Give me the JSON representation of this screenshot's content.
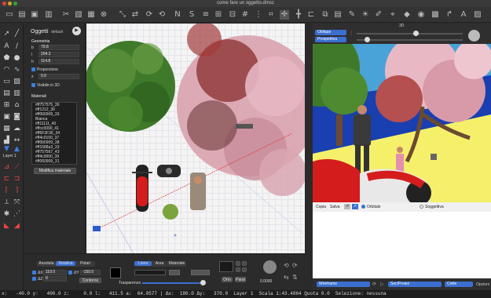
{
  "window": {
    "title": "come fare un oggetto.dmsc"
  },
  "toolbar": {
    "icons": [
      "new-icon",
      "open-icon",
      "save-icon",
      "print-icon",
      "cut-icon",
      "copy-icon",
      "paste-icon",
      "delete-icon",
      "resize-icon",
      "mirror-icon",
      "rotate-icon",
      "N-icon",
      "S-icon",
      "align-icon",
      "grid-icon",
      "snap-icon",
      "move-icon",
      "distribute-icon",
      "group-icon",
      "layers-icon",
      "tool-icon",
      "light-icon",
      "measure-icon",
      "brush-icon",
      "cube-icon",
      "camera-icon",
      "material-icon",
      "hook-icon",
      "text-icon",
      "export-icon"
    ]
  },
  "objects_panel": {
    "title": "Oggetti",
    "mode": "default",
    "section_geometry": "Geometria",
    "b_label": "b",
    "b_value": "79.8",
    "l_label": "l",
    "l_value": "204.2",
    "h_label": "h",
    "h_value": "114.8",
    "proportion_label": "Proporzione",
    "z_label": "z",
    "z_value": "0.0",
    "visible3d_label": "Visibile in 3D",
    "section_materials": "Materiali",
    "materials": [
      "#ff757575_36",
      "#ff1212_30",
      "#ff060909_33",
      "Bianca",
      "#ff11111_40",
      "#ffcc0000_41",
      "#ff6F3F36_34",
      "#ff4c0100_37",
      "#ff060909_38",
      "#ff1588a3_33",
      "#ff757567_43",
      "#ff4c0000_39",
      "#ff060909_31"
    ],
    "edit_material_button": "Modifica materiale",
    "layer_label": "Layer 1"
  },
  "bottom_panel": {
    "tabs": [
      "Assoluta",
      "Relativa",
      "Polari"
    ],
    "dx_label": "ΔX",
    "dx_value": "110.0",
    "dz_label": "ΔZ",
    "dz_value": "0",
    "dy_label": "ΔY",
    "dy_value": "-150.0",
    "fill_button": "Contorno",
    "style_tabs": [
      "Linea",
      "Area",
      "Materiale"
    ],
    "transparency_label": "Trasparenza",
    "ortho_button": "Orto",
    "parall_button": "Paral",
    "angle_value": "0.0000"
  },
  "view3d": {
    "title": "3D",
    "view_select": "Oblique",
    "projection_select": "Prospettiva",
    "ctrl_copy": "Copia",
    "ctrl_save": "Salva",
    "orbit_label": "Orbitale",
    "subjective_label": "Soggettiva",
    "render_select": "Wireframe",
    "shadow_select": "Sec/Proiez",
    "style_select": "Civile",
    "options_label": "Opzioni"
  },
  "status": {
    "text": "x:   -40.0 y:   400.0 z:     0.0 l:   411.5 a:  64.0577 | Δx:  180.0 Δy:   370.0  Layer 1  Scala 1:43.4864 Quota 0.0  Selezione: nessuna"
  },
  "colors": {
    "accent": "#3b6fd0",
    "panel": "#2b2b2b",
    "canvas": "#f4f4f4",
    "ground": "#f5f06a",
    "sky": "#4aa3d8"
  }
}
